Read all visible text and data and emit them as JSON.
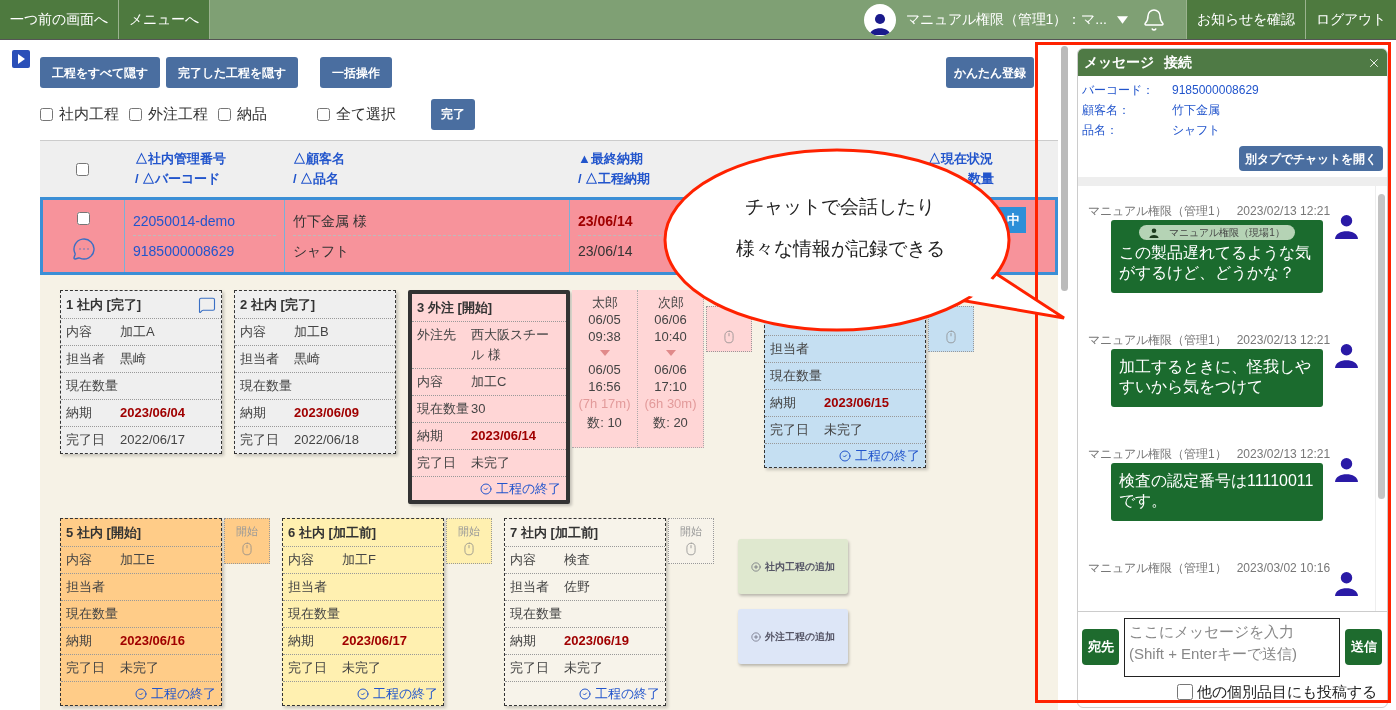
{
  "top_bar": {
    "nav_buttons": [
      "一つ前の画面へ",
      "メニューへ"
    ],
    "user_name": "マニュアル権限（管理1）：マ...",
    "right_buttons": [
      "お知らせを確認",
      "ログアウト"
    ]
  },
  "toolbar": {
    "buttons": [
      "工程をすべて隠す",
      "完了した工程を隠す",
      "一括操作"
    ],
    "right_button": "かんたん登録"
  },
  "filters": [
    {
      "label": "社内工程",
      "checked": false
    },
    {
      "label": "外注工程",
      "checked": false
    },
    {
      "label": "納品",
      "checked": false
    }
  ],
  "select_all": {
    "label": "全て選択",
    "checked": false
  },
  "complete_button": "完了",
  "table": {
    "header_checked": false,
    "columns": [
      {
        "lines": [
          "△社内管理番号",
          "/ △バーコード"
        ]
      },
      {
        "lines": [
          "△顧客名",
          "/ △品名"
        ]
      },
      {
        "lines": [
          "▲最終納期",
          "/ △工程納期"
        ]
      }
    ],
    "status_column": {
      "lines": [
        "△現在状況",
        "数量"
      ]
    },
    "row": {
      "checked": false,
      "selected": true,
      "management_no": "22050014-demo",
      "barcode": "9185000008629",
      "customer": "竹下金属 様",
      "product": "シャフト",
      "final_due": "23/06/14",
      "process_due": "23/06/14",
      "status": "中"
    }
  },
  "process_rows": [
    [
      {
        "kind": "card",
        "title": "1 社内 [完了]",
        "color": "#efefef",
        "selected": false,
        "comment": true,
        "fields": [
          {
            "kind": "plain",
            "label": "内容",
            "value": "加工A"
          },
          {
            "kind": "plain",
            "label": "担当者",
            "value": "黒崎"
          },
          {
            "label": "現在数量"
          },
          {
            "kind": "due",
            "label": "納期",
            "value": "2023/06/04"
          },
          {
            "kind": "plain",
            "label": "完了日",
            "value": "2022/06/17"
          }
        ]
      },
      {
        "kind": "card",
        "title": "2 社内 [完了]",
        "color": "#efefef",
        "selected": false,
        "comment": false,
        "fields": [
          {
            "kind": "plain",
            "label": "内容",
            "value": "加工B"
          },
          {
            "kind": "plain",
            "label": "担当者",
            "value": "黒崎"
          },
          {
            "label": "現在数量"
          },
          {
            "kind": "due",
            "label": "納期",
            "value": "2023/06/09"
          },
          {
            "kind": "plain",
            "label": "完了日",
            "value": "2022/06/18"
          }
        ]
      },
      {
        "kind": "card",
        "title": "3 外注 [開始]",
        "color": "#ffd6d6",
        "selected": true,
        "comment": false,
        "fields": [
          {
            "kind": "plain",
            "label": "外注先",
            "value": "西大阪スチール 様"
          },
          {
            "kind": "plain",
            "label": "内容",
            "value": "加工C"
          },
          {
            "kind": "plain",
            "label": "現在数量",
            "value": "30"
          },
          {
            "kind": "due",
            "label": "納期",
            "value": "2023/06/14"
          },
          {
            "kind": "plain",
            "label": "完了日",
            "value": "未完了"
          }
        ],
        "finish": "工程の終了"
      },
      {
        "kind": "time_log",
        "entries": [
          {
            "worker": "太郎",
            "start_date": "06/05",
            "start_time": "09:38",
            "end_date": "06/05",
            "end_time": "16:56",
            "duration": "(7h 17m)",
            "count": "数: 10"
          },
          {
            "worker": "次郎",
            "start_date": "06/06",
            "start_time": "10:40",
            "end_date": "06/06",
            "end_time": "17:10",
            "duration": "(6h 30m)",
            "count": "数: 20"
          }
        ]
      },
      {
        "kind": "start_box",
        "color": "#ffd6d6"
      },
      {
        "kind": "card",
        "color": "#c5dff2",
        "selected": false,
        "fields": [
          {
            "label": "担当者"
          },
          {
            "label": "現在数量"
          },
          {
            "kind": "due",
            "label": "納期",
            "value": "2023/06/15"
          },
          {
            "kind": "plain",
            "label": "完了日",
            "value": "未完了"
          }
        ],
        "finish": "工程の終了"
      },
      {
        "kind": "start_box",
        "color": "#c5dff2"
      }
    ],
    [
      {
        "kind": "card",
        "title": "5 社内 [開始]",
        "color": "#ffcc88",
        "selected": false,
        "comment": false,
        "fields": [
          {
            "kind": "plain",
            "label": "内容",
            "value": "加工E"
          },
          {
            "label": "担当者"
          },
          {
            "label": "現在数量"
          },
          {
            "kind": "due",
            "label": "納期",
            "value": "2023/06/16"
          },
          {
            "kind": "plain",
            "label": "完了日",
            "value": "未完了"
          }
        ],
        "finish": "工程の終了"
      },
      {
        "kind": "start_box",
        "color": "#ffcc88",
        "label": "開始"
      },
      {
        "kind": "card",
        "title": "6 社内 [加工前]",
        "color": "#fff0b0",
        "selected": false,
        "comment": false,
        "fields": [
          {
            "kind": "plain",
            "label": "内容",
            "value": "加工F"
          },
          {
            "label": "担当者"
          },
          {
            "label": "現在数量"
          },
          {
            "kind": "due",
            "label": "納期",
            "value": "2023/06/17"
          },
          {
            "kind": "plain",
            "label": "完了日",
            "value": "未完了"
          }
        ],
        "finish": "工程の終了"
      },
      {
        "kind": "start_box",
        "color": "#fff0b0",
        "label": "開始"
      },
      {
        "kind": "card",
        "title": "7 社内 [加工前]",
        "color": "#f7f3ea",
        "selected": false,
        "comment": false,
        "fields": [
          {
            "kind": "plain",
            "label": "内容",
            "value": "検査"
          },
          {
            "kind": "plain",
            "label": "担当者",
            "value": "佐野"
          },
          {
            "label": "現在数量"
          },
          {
            "kind": "due",
            "label": "納期",
            "value": "2023/06/19"
          },
          {
            "kind": "plain",
            "label": "完了日",
            "value": "未完了"
          }
        ],
        "finish": "工程の終了"
      },
      {
        "kind": "start_box",
        "color": "#f7f3ea",
        "label": "開始"
      },
      {
        "kind": "add_buttons",
        "buttons": [
          {
            "label": "社内工程の追加",
            "color": "#dfe8cf"
          },
          {
            "label": "外注工程の追加",
            "color": "#dde6f7"
          }
        ]
      }
    ]
  ],
  "callout": {
    "lines": [
      "チャットで会話したり",
      "様々な情報が記録できる"
    ]
  },
  "message_panel": {
    "title": "メッセージ",
    "status": "接続",
    "info": [
      {
        "label": "バーコード：",
        "value": "9185000008629"
      },
      {
        "label": "顧客名：",
        "value": "竹下金属"
      },
      {
        "label": "品名：",
        "value": "シャフト"
      }
    ],
    "open_tab_button": "別タブでチャットを開く",
    "messages": [
      {
        "sender": "マニュアル権限（管理1）",
        "time": "2023/02/13 12:21",
        "to": "マニュアル権限（現場1）",
        "text": "この製品遅れてるような気がするけど、どうかな？"
      },
      {
        "sender": "マニュアル権限（管理1）",
        "time": "2023/02/13 12:21",
        "text": "加工するときに、怪我しやすいから気をつけて"
      },
      {
        "sender": "マニュアル権限（管理1）",
        "time": "2023/02/13 12:21",
        "text": "検査の認定番号は11110011です。"
      },
      {
        "sender": "マニュアル権限（管理1）",
        "time": "2023/03/02 10:16"
      }
    ],
    "recipient_button": "宛先",
    "input_placeholder": "ここにメッセージを入力\n(Shift + Enterキーで送信)",
    "send_button": "送信",
    "post_other": {
      "label": "他の個別品目にも投稿する",
      "checked": false
    }
  }
}
